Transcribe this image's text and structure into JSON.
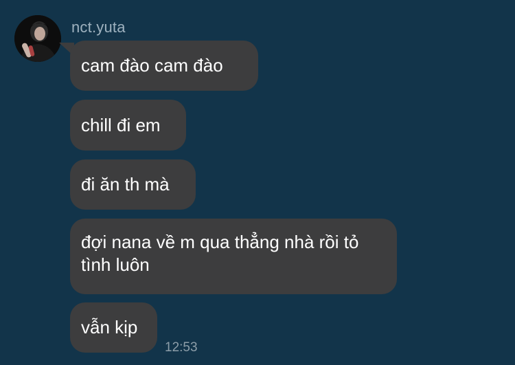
{
  "sender": {
    "name": "nct.yuta"
  },
  "messages": [
    {
      "text": "cam đào cam đào"
    },
    {
      "text": "chill đi em"
    },
    {
      "text": "đi ăn th mà"
    },
    {
      "text": "đợi nana về m qua thẳng nhà rồi tỏ tình luôn"
    },
    {
      "text": "vẫn kịp"
    }
  ],
  "timestamp": "12:53",
  "colors": {
    "background": "#12344a",
    "bubble": "#3d3d3e",
    "text": "#ffffff",
    "sender_name": "#9fb2bf",
    "timestamp": "#8d9ea9"
  },
  "icons": {
    "avatar": "profile-photo"
  }
}
